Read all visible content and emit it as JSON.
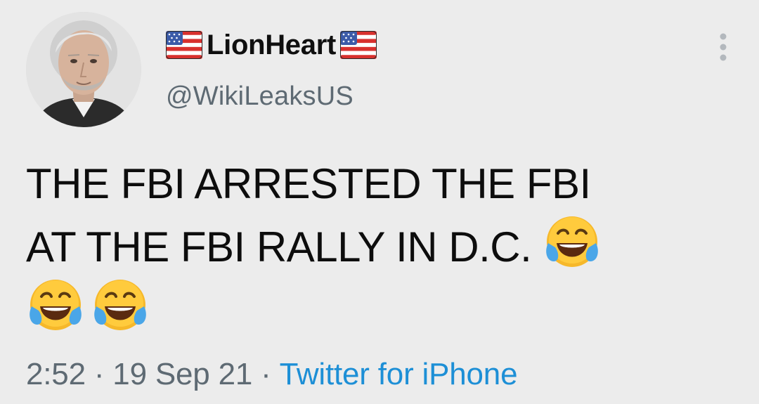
{
  "user": {
    "display_name": "LionHeart",
    "handle": "@WikiLeaksUS",
    "name_prefix_icon": "us-flag-icon",
    "name_suffix_icon": "us-flag-icon",
    "avatar_icon": "profile-photo"
  },
  "tweet": {
    "line1": "THE FBI ARRESTED THE FBI",
    "line2": "AT THE FBI RALLY IN D.C.",
    "emoji_icon": "face-with-tears-of-joy-icon",
    "emoji_count": 3
  },
  "meta": {
    "time": "2:52",
    "separator": "·",
    "date": "19 Sep 21",
    "source": "Twitter for iPhone"
  },
  "menu": {
    "icon": "more-vertical-icon"
  },
  "colors": {
    "background": "#ececec",
    "text": "#0d0d0d",
    "secondary": "#5e6a73",
    "link": "#1d8fd6"
  }
}
